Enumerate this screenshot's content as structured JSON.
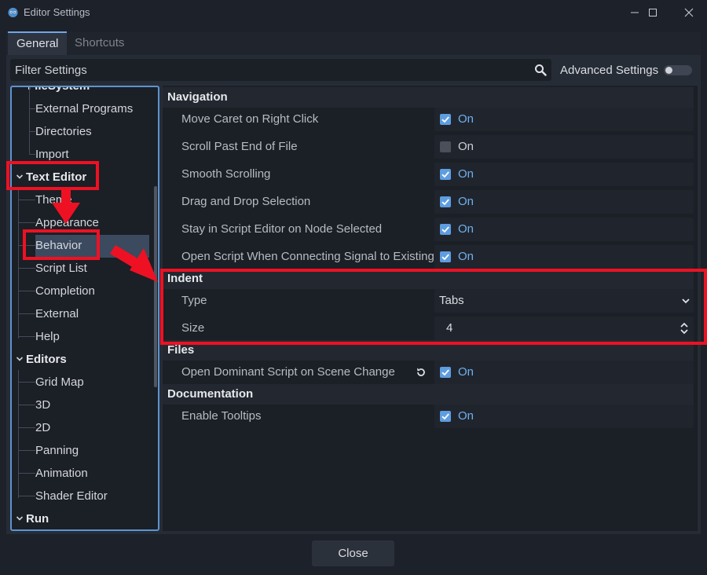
{
  "window": {
    "title": "Editor Settings",
    "controls": {
      "minimize_icon": "minimize-icon",
      "maximize_icon": "maximize-icon",
      "close_icon": "close-icon"
    }
  },
  "tabs": [
    {
      "label": "General",
      "active": true
    },
    {
      "label": "Shortcuts",
      "active": false
    }
  ],
  "filter": {
    "placeholder": "Filter Settings",
    "icon": "search-icon"
  },
  "advanced": {
    "label": "Advanced Settings",
    "enabled": false
  },
  "tree": {
    "partial_top": "FileSystem",
    "filesystem_items": [
      "External Programs",
      "Directories",
      "Import"
    ],
    "text_editor": {
      "label": "Text Editor",
      "items": [
        "Theme",
        "Appearance",
        "Behavior",
        "Script List",
        "Completion",
        "External",
        "Help"
      ]
    },
    "editors": {
      "label": "Editors",
      "items": [
        "Grid Map",
        "3D",
        "2D",
        "Panning",
        "Animation",
        "Shader Editor"
      ]
    },
    "run": {
      "label": "Run"
    },
    "selected": "Behavior"
  },
  "sections": {
    "navigation": {
      "title": "Navigation",
      "rows": [
        {
          "label": "Move Caret on Right Click",
          "value": "On",
          "checked": true
        },
        {
          "label": "Scroll Past End of File",
          "value": "On",
          "checked": false
        },
        {
          "label": "Smooth Scrolling",
          "value": "On",
          "checked": true
        },
        {
          "label": "Drag and Drop Selection",
          "value": "On",
          "checked": true
        },
        {
          "label": "Stay in Script Editor on Node Selected",
          "value": "On",
          "checked": true
        },
        {
          "label": "Open Script When Connecting Signal to Existing",
          "value": "On",
          "checked": true
        }
      ]
    },
    "indent": {
      "title": "Indent",
      "type": {
        "label": "Type",
        "value": "Tabs"
      },
      "size": {
        "label": "Size",
        "value": "4"
      }
    },
    "files": {
      "title": "Files",
      "rows": [
        {
          "label": "Open Dominant Script on Scene Change",
          "value": "On",
          "checked": true,
          "revert_icon": "revert-icon"
        }
      ]
    },
    "documentation": {
      "title": "Documentation",
      "rows": [
        {
          "label": "Enable Tooltips",
          "value": "On",
          "checked": true
        }
      ]
    }
  },
  "footer": {
    "close_label": "Close"
  },
  "colors": {
    "accent": "#6fb0f0",
    "highlight": "#ee1123",
    "selection": "#3b4a5e"
  }
}
